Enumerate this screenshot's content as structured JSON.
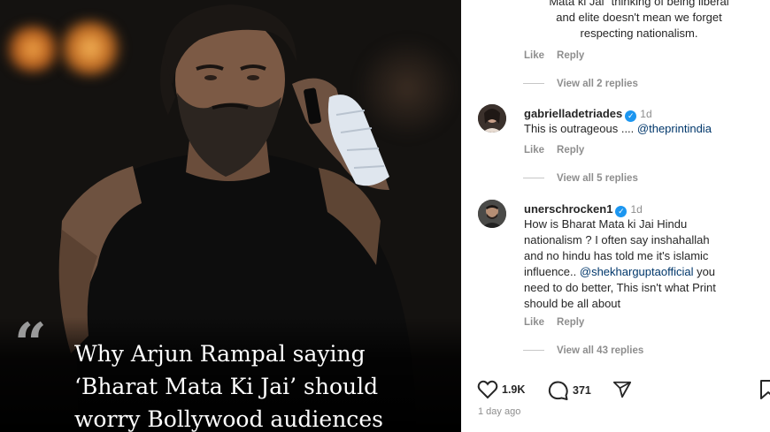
{
  "post": {
    "headline_lines": [
      "Why Arjun Rampal saying",
      "‘Bharat Mata Ki Jai’ should",
      "worry Bollywood audiences"
    ],
    "quote_glyph": "“"
  },
  "comments": {
    "truncated": {
      "line1": "Mata ki Jai\" thinking of being liberal",
      "line2": "and elite doesn't mean we forget",
      "line3": "respecting nationalism.",
      "like": "Like",
      "reply": "Reply",
      "view_replies": "View all 2 replies"
    },
    "c1": {
      "username": "gabrielladetriades",
      "username_display": "gabrielladetriades",
      "time": "1d",
      "text": "This is outrageous .... ",
      "mention": "@theprintindia",
      "like": "Like",
      "reply": "Reply",
      "view_replies": "View all 5 replies"
    },
    "c2": {
      "username": "unerschrocken1",
      "time": "1d",
      "text_a": "How is Bharat Mata ki Jai Hindu",
      "text_b": "nationalism ? I often say inshahallah",
      "text_c": "and no hindu has told me it's islamic",
      "text_d": "influence.. ",
      "mention": "@shekharguptaofficial",
      "text_e": " you",
      "text_f": "need to do better, This isn't what Print",
      "text_g": "should be all about",
      "like": "Like",
      "reply": "Reply",
      "view_replies": "View all 43 replies"
    }
  },
  "footer": {
    "likes": "1.9K",
    "comments": "371",
    "posted": "1 day ago"
  },
  "icons": {
    "heart": "heart-icon",
    "comment": "comment-icon",
    "share": "share-icon",
    "save": "bookmark-icon",
    "verified": "verified-badge-icon"
  },
  "colors": {
    "verified": "#1c96f0",
    "mention": "#00376b",
    "muted": "#8e8e8e"
  }
}
